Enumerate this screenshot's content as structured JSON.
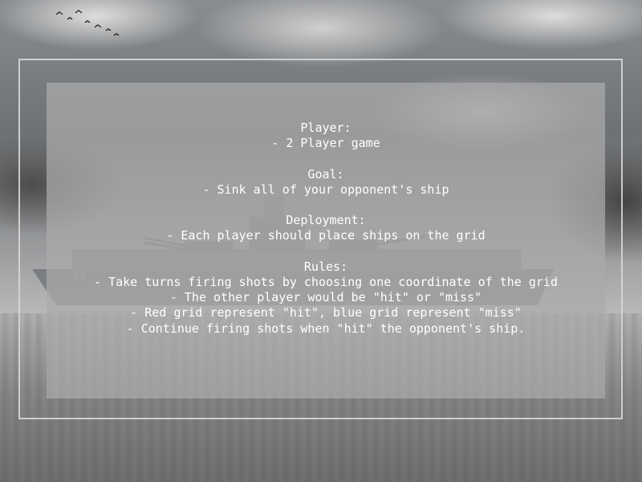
{
  "rules_screen": {
    "sections": [
      {
        "heading": "Player:",
        "lines": [
          "- 2 Player game"
        ]
      },
      {
        "heading": "Goal:",
        "lines": [
          "- Sink all of your opponent's ship"
        ]
      },
      {
        "heading": "Deployment:",
        "lines": [
          "- Each player should place ships on the grid"
        ]
      },
      {
        "heading": "Rules:",
        "lines": [
          "- Take turns firing shots by choosing one coordinate of the grid",
          "- The other player would be \"hit\" or \"miss\"",
          "- Red grid represent \"hit\", blue grid represent \"miss\"",
          "- Continue firing shots when \"hit\" the opponent's ship."
        ]
      }
    ]
  }
}
